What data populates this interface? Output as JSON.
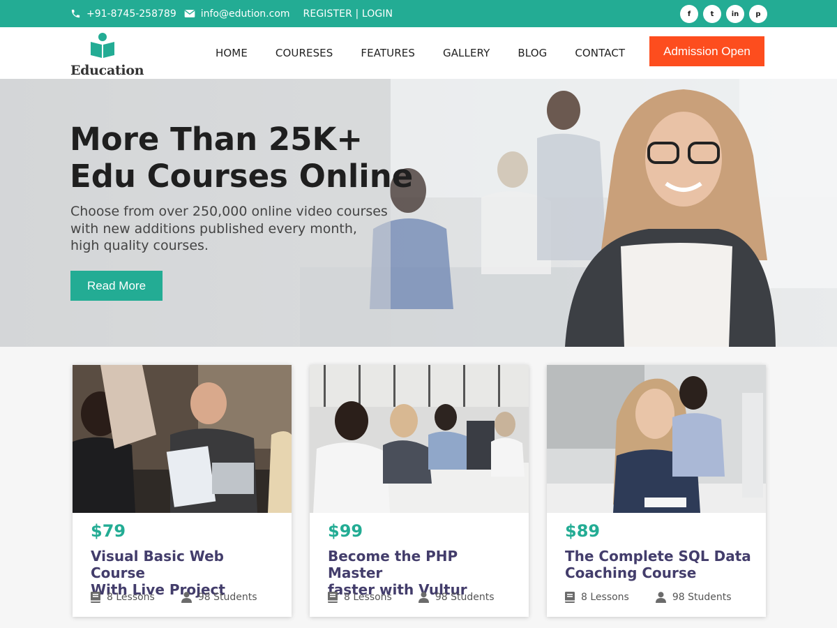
{
  "topbar": {
    "phone": "+91-8745-258789",
    "email": "info@edution.com",
    "auth": "REGISTER | LOGIN",
    "social": [
      {
        "icon": "facebook-icon",
        "glyph": "f"
      },
      {
        "icon": "twitter-icon",
        "glyph": "t"
      },
      {
        "icon": "linkedin-icon",
        "glyph": "in"
      },
      {
        "icon": "pinterest-icon",
        "glyph": "p"
      }
    ]
  },
  "header": {
    "logo_text": "Education",
    "nav": [
      "HOME",
      "COURESES",
      "FEATURES",
      "GALLERY",
      "BLOG",
      "CONTACT"
    ],
    "cta": "Admission Open"
  },
  "hero": {
    "title_line1": "More Than 25K+",
    "title_line2": "Edu Courses Online",
    "subtitle_line1": "Choose from over 250,000 online video courses",
    "subtitle_line2": "with new additions published every month,",
    "subtitle_line3": "high quality courses.",
    "button": "Read More"
  },
  "courses": [
    {
      "price": "$79",
      "title_line1": "Visual Basic Web Course",
      "title_line2": "With Live Project",
      "lessons": "8 Lessons",
      "students": "98 Students"
    },
    {
      "price": "$99",
      "title_line1": "Become the PHP Master",
      "title_line2": "faster with Vultur",
      "lessons": "8 Lessons",
      "students": "98 Students"
    },
    {
      "price": "$89",
      "title_line1": "The Complete SQL Data",
      "title_line2": "Coaching Course",
      "lessons": "8 Lessons",
      "students": "98 Students"
    }
  ],
  "colors": {
    "primary": "#23ac94",
    "accent": "#fd4d1e",
    "heading": "#433d6b"
  }
}
